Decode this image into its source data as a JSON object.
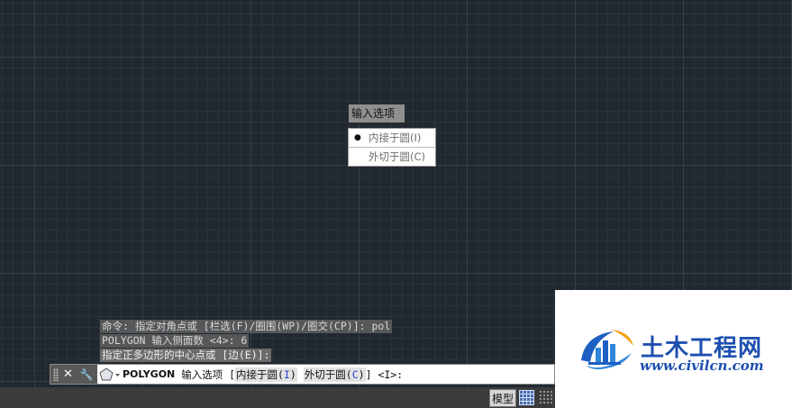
{
  "popup": {
    "title": "输入选项",
    "options": [
      {
        "label": "内接于圆(I)",
        "selected": true
      },
      {
        "label": "外切于圆(C)",
        "selected": false
      }
    ]
  },
  "history": [
    "命令: 指定对角点或 [栏选(F)/圈围(WP)/圈交(CP)]: pol",
    "POLYGON 输入侧面数 <4>: 6",
    "指定正多边形的中心点或 [边(E)]:"
  ],
  "command": {
    "name": "POLYGON",
    "prompt": " 输入选项 [",
    "opt1_label": "内接于圆(",
    "opt1_key": "I",
    "opt1_close": ")",
    "opt2_label": "外切于圆(",
    "opt2_key": "C",
    "opt2_close": ")",
    "suffix": "] <I>:"
  },
  "status": {
    "model_tab": "模型"
  },
  "watermark": {
    "title": "土木工程网",
    "url": "www.civilcn.com"
  },
  "colors": {
    "canvas": "#212830",
    "accent": "#1d4fb0",
    "option_key": "#2b3fd4"
  }
}
